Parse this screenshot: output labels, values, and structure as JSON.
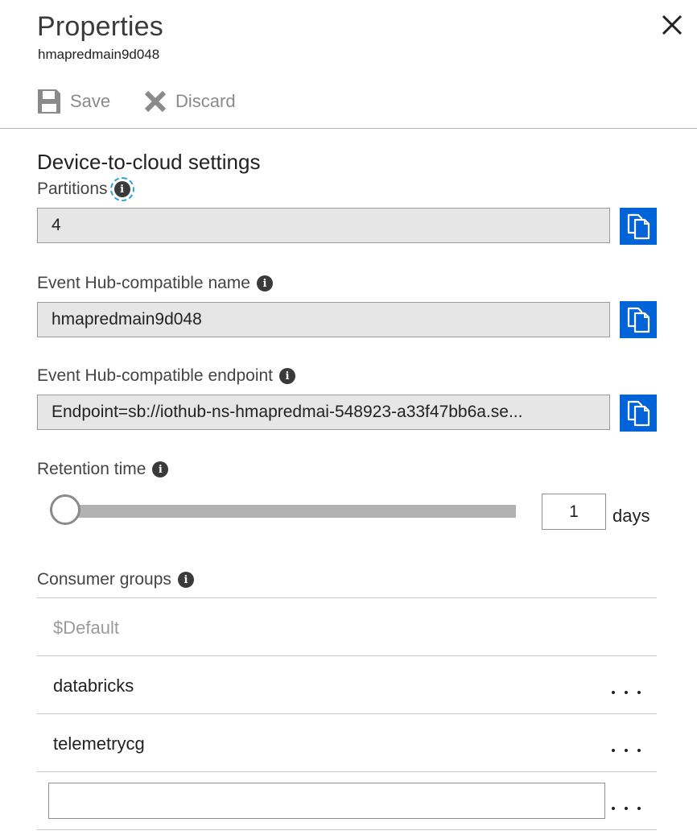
{
  "header": {
    "title": "Properties",
    "subtitle": "hmapredmain9d048"
  },
  "toolbar": {
    "save_label": "Save",
    "discard_label": "Discard"
  },
  "section": {
    "title": "Device-to-cloud settings"
  },
  "fields": {
    "partitions": {
      "label": "Partitions",
      "value": "4"
    },
    "eventhub_name": {
      "label": "Event Hub-compatible name",
      "value": "hmapredmain9d048"
    },
    "eventhub_endpoint": {
      "label": "Event Hub-compatible endpoint",
      "value": "Endpoint=sb://iothub-ns-hmapredmai-548923-a33f47bb6a.se..."
    }
  },
  "retention": {
    "label": "Retention time",
    "value": "1",
    "unit": "days",
    "slider_fraction": 0.0
  },
  "consumer_groups": {
    "label": "Consumer groups",
    "items": [
      {
        "name": "$Default",
        "muted": true
      },
      {
        "name": "databricks"
      },
      {
        "name": "telemetrycg"
      }
    ],
    "new_value": ""
  },
  "colors": {
    "accent": "#0063d8",
    "muted_text": "#8a8a8a",
    "readonly_bg": "#e6e6e6",
    "focus_outline": "#2aa3d8"
  },
  "icons": {
    "close": "close-icon",
    "save": "save-icon",
    "discard": "discard-icon",
    "info": "info-icon",
    "copy": "copy-icon",
    "more": "more-icon"
  }
}
